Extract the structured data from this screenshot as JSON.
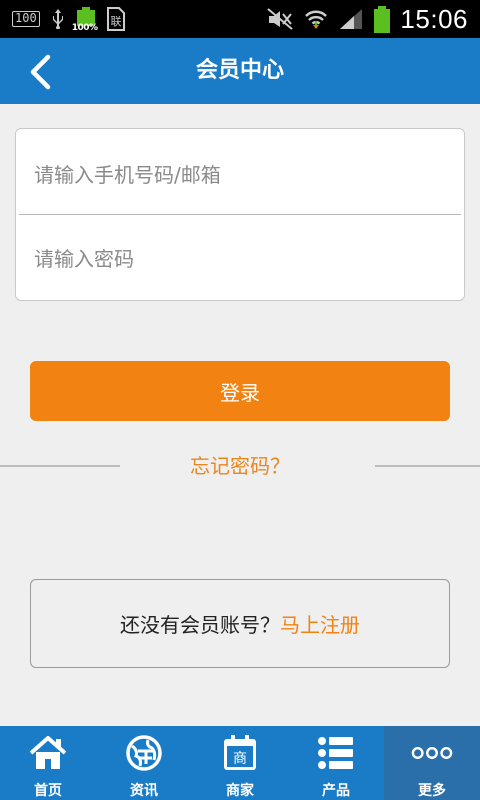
{
  "status_bar": {
    "left_box": "100",
    "battery_small_pct": "100%",
    "doc_label": "联",
    "time": "15:06"
  },
  "header": {
    "title": "会员中心"
  },
  "login_form": {
    "phone_placeholder": "请输入手机号码/邮箱",
    "password_placeholder": "请输入密码",
    "login_label": "登录",
    "forgot_label": "忘记密码？"
  },
  "register": {
    "text": "还没有会员账号？",
    "link": "马上注册"
  },
  "bottom_nav": {
    "items": [
      {
        "label": "首页",
        "icon": "home-icon"
      },
      {
        "label": "资讯",
        "icon": "globe-icon"
      },
      {
        "label": "商家",
        "icon": "merchant-calendar-icon",
        "icon_text": "商"
      },
      {
        "label": "产品",
        "icon": "list-icon"
      },
      {
        "label": "更多",
        "icon": "more-dots-icon"
      }
    ],
    "active_index": 4
  },
  "colors": {
    "primary": "#1a7bc6",
    "accent": "#f28313",
    "background": "#efefef"
  }
}
